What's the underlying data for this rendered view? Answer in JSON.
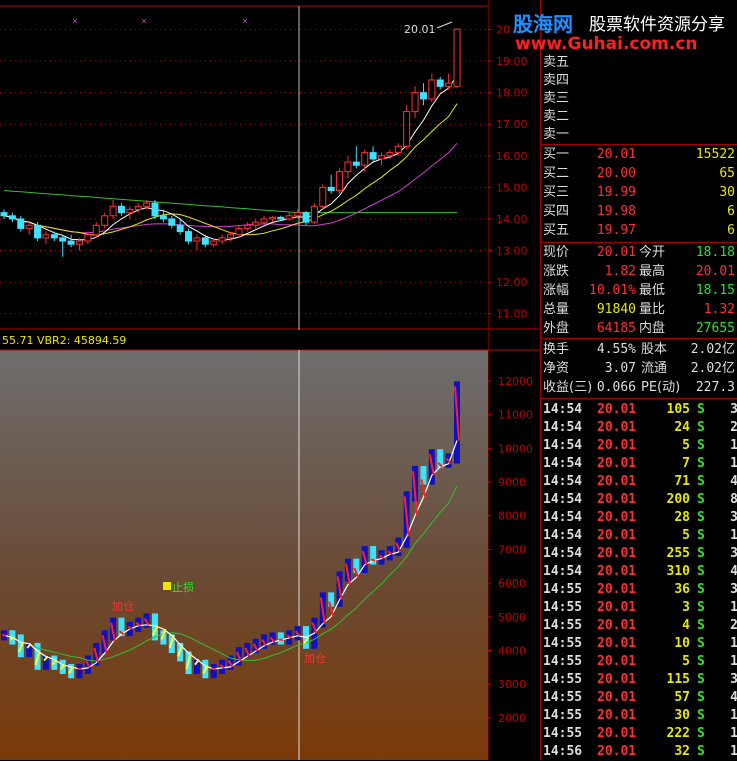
{
  "logo": {
    "brand": "股海网",
    "slogan": "股票软件资源分享",
    "url": "www.Guhai.com.cn"
  },
  "upper": {
    "price_label": "20.01",
    "axis_ticks": [
      "20",
      "19.00",
      "18.00",
      "17.00",
      "16.00",
      "15.00",
      "14.00",
      "13.00",
      "12.00",
      "11.00"
    ],
    "axis_values": [
      20,
      19,
      18,
      17,
      16,
      15,
      14,
      13,
      12,
      11
    ]
  },
  "indicator": {
    "header": "55.71  VBR2: 45894.59",
    "stop_label": "止损",
    "buy_label_1": "加仓",
    "buy_label_2": "加仓",
    "axis_ticks": [
      "12000",
      "11000",
      "10000",
      "9000",
      "8000",
      "7000",
      "6000",
      "5000",
      "4000",
      "3000",
      "2000"
    ],
    "axis_values": [
      12000,
      11000,
      10000,
      9000,
      8000,
      7000,
      6000,
      5000,
      4000,
      3000,
      2000
    ]
  },
  "sell_levels": [
    "卖五",
    "卖四",
    "卖三",
    "卖二",
    "卖一"
  ],
  "bids": [
    {
      "label": "买一",
      "price": "20.01",
      "vol": "15522"
    },
    {
      "label": "买二",
      "price": "20.00",
      "vol": "65"
    },
    {
      "label": "买三",
      "price": "19.99",
      "vol": "30"
    },
    {
      "label": "买四",
      "price": "19.98",
      "vol": "6"
    },
    {
      "label": "买五",
      "price": "19.97",
      "vol": "6"
    }
  ],
  "stats": [
    {
      "l1": "现价",
      "v1": "20.01",
      "c1": "#ff3030",
      "l2": "今开",
      "v2": "18.18",
      "c2": "#30e030"
    },
    {
      "l1": "涨跌",
      "v1": "1.82",
      "c1": "#ff3030",
      "l2": "最高",
      "v2": "20.01",
      "c2": "#ff3030"
    },
    {
      "l1": "涨幅",
      "v1": "10.01%",
      "c1": "#ff3030",
      "l2": "最低",
      "v2": "18.15",
      "c2": "#30e030"
    },
    {
      "l1": "总量",
      "v1": "91840",
      "c1": "#e8e800",
      "l2": "量比",
      "v2": "1.32",
      "c2": "#ff3030"
    },
    {
      "l1": "外盘",
      "v1": "64185",
      "c1": "#ff3030",
      "l2": "内盘",
      "v2": "27655",
      "c2": "#30e030"
    }
  ],
  "fund": [
    {
      "l1": "换手",
      "v1": "4.55%",
      "l2": "股本",
      "v2": "2.02亿"
    },
    {
      "l1": "净资",
      "v1": "3.07",
      "l2": "流通",
      "v2": "2.02亿"
    },
    {
      "l1": "收益(三)",
      "v1": "0.066",
      "l2": "PE(动)",
      "v2": "227.3"
    }
  ],
  "ticks": [
    {
      "t": "14:54",
      "p": "20.01",
      "v": "105",
      "s": "S",
      "n": "3"
    },
    {
      "t": "14:54",
      "p": "20.01",
      "v": "24",
      "s": "S",
      "n": "2"
    },
    {
      "t": "14:54",
      "p": "20.01",
      "v": "5",
      "s": "S",
      "n": "1"
    },
    {
      "t": "14:54",
      "p": "20.01",
      "v": "7",
      "s": "S",
      "n": "1"
    },
    {
      "t": "14:54",
      "p": "20.01",
      "v": "71",
      "s": "S",
      "n": "4"
    },
    {
      "t": "14:54",
      "p": "20.01",
      "v": "200",
      "s": "S",
      "n": "8"
    },
    {
      "t": "14:54",
      "p": "20.01",
      "v": "28",
      "s": "S",
      "n": "3"
    },
    {
      "t": "14:54",
      "p": "20.01",
      "v": "5",
      "s": "S",
      "n": "1"
    },
    {
      "t": "14:54",
      "p": "20.01",
      "v": "255",
      "s": "S",
      "n": "3"
    },
    {
      "t": "14:54",
      "p": "20.01",
      "v": "310",
      "s": "S",
      "n": "4"
    },
    {
      "t": "14:55",
      "p": "20.01",
      "v": "36",
      "s": "S",
      "n": "3"
    },
    {
      "t": "14:55",
      "p": "20.01",
      "v": "3",
      "s": "S",
      "n": "1"
    },
    {
      "t": "14:55",
      "p": "20.01",
      "v": "4",
      "s": "S",
      "n": "2"
    },
    {
      "t": "14:55",
      "p": "20.01",
      "v": "10",
      "s": "S",
      "n": "1"
    },
    {
      "t": "14:55",
      "p": "20.01",
      "v": "5",
      "s": "S",
      "n": "1"
    },
    {
      "t": "14:55",
      "p": "20.01",
      "v": "115",
      "s": "S",
      "n": "3"
    },
    {
      "t": "14:55",
      "p": "20.01",
      "v": "57",
      "s": "S",
      "n": "4"
    },
    {
      "t": "14:55",
      "p": "20.01",
      "v": "30",
      "s": "S",
      "n": "1"
    },
    {
      "t": "14:55",
      "p": "20.01",
      "v": "222",
      "s": "S",
      "n": "1"
    },
    {
      "t": "14:56",
      "p": "20.01",
      "v": "32",
      "s": "S",
      "n": "1"
    }
  ],
  "colors": {
    "up": "#ff3030",
    "down": "#40e0ff",
    "grid": "#c00000",
    "ma5": "#ffffff",
    "ma10": "#e8e800",
    "ma20": "#d040d0",
    "ma60": "#30c030"
  },
  "chart_data": {
    "type": "candlestick",
    "ylim": [
      10.5,
      20.3
    ],
    "candles": [
      [
        14.2,
        14.3,
        14.0,
        14.1
      ],
      [
        14.1,
        14.2,
        13.9,
        14.0
      ],
      [
        14.0,
        14.1,
        13.6,
        13.7
      ],
      [
        13.7,
        13.9,
        13.5,
        13.8
      ],
      [
        13.8,
        13.9,
        13.3,
        13.4
      ],
      [
        13.4,
        13.6,
        13.2,
        13.5
      ],
      [
        13.5,
        13.6,
        13.3,
        13.4
      ],
      [
        13.4,
        13.5,
        12.8,
        13.3
      ],
      [
        13.3,
        13.5,
        13.1,
        13.2
      ],
      [
        13.2,
        13.4,
        13.0,
        13.3
      ],
      [
        13.3,
        13.6,
        13.2,
        13.5
      ],
      [
        13.5,
        13.9,
        13.4,
        13.8
      ],
      [
        13.8,
        14.2,
        13.7,
        14.1
      ],
      [
        14.1,
        14.6,
        14.0,
        14.4
      ],
      [
        14.4,
        14.5,
        14.1,
        14.2
      ],
      [
        14.2,
        14.4,
        14.0,
        14.3
      ],
      [
        14.3,
        14.5,
        14.2,
        14.4
      ],
      [
        14.4,
        14.6,
        14.3,
        14.5
      ],
      [
        14.5,
        14.6,
        14.0,
        14.1
      ],
      [
        14.1,
        14.3,
        13.9,
        14.0
      ],
      [
        14.0,
        14.1,
        13.7,
        13.8
      ],
      [
        13.8,
        14.0,
        13.5,
        13.6
      ],
      [
        13.6,
        13.7,
        13.2,
        13.3
      ],
      [
        13.3,
        13.5,
        13.0,
        13.4
      ],
      [
        13.4,
        13.5,
        13.1,
        13.2
      ],
      [
        13.2,
        13.4,
        13.1,
        13.3
      ],
      [
        13.3,
        13.5,
        13.2,
        13.4
      ],
      [
        13.4,
        13.6,
        13.3,
        13.5
      ],
      [
        13.5,
        13.8,
        13.4,
        13.7
      ],
      [
        13.7,
        13.9,
        13.6,
        13.8
      ],
      [
        13.8,
        14.0,
        13.7,
        13.9
      ],
      [
        13.9,
        14.1,
        13.8,
        14.0
      ],
      [
        14.0,
        14.1,
        13.9,
        14.05
      ],
      [
        14.05,
        14.1,
        13.95,
        14.0
      ],
      [
        14.0,
        14.2,
        13.95,
        14.1
      ],
      [
        14.1,
        14.3,
        14.0,
        14.2
      ],
      [
        14.2,
        14.25,
        13.8,
        13.9
      ],
      [
        13.9,
        14.5,
        13.85,
        14.4
      ],
      [
        14.4,
        15.1,
        14.3,
        15.0
      ],
      [
        15.0,
        15.4,
        14.8,
        14.9
      ],
      [
        14.9,
        15.6,
        14.8,
        15.5
      ],
      [
        15.5,
        16.0,
        15.3,
        15.8
      ],
      [
        15.8,
        16.3,
        15.6,
        15.7
      ],
      [
        15.7,
        16.2,
        15.5,
        16.1
      ],
      [
        16.1,
        16.3,
        15.8,
        15.9
      ],
      [
        15.9,
        16.1,
        15.7,
        16.0
      ],
      [
        16.0,
        16.2,
        15.9,
        16.1
      ],
      [
        16.1,
        16.4,
        16.0,
        16.3
      ],
      [
        16.3,
        17.6,
        16.2,
        17.4
      ],
      [
        17.4,
        18.2,
        17.2,
        18.0
      ],
      [
        18.0,
        18.3,
        17.6,
        17.8
      ],
      [
        17.8,
        18.6,
        17.7,
        18.4
      ],
      [
        18.4,
        18.5,
        18.1,
        18.2
      ],
      [
        18.2,
        18.6,
        18.1,
        18.3
      ],
      [
        18.2,
        20.01,
        18.15,
        20.01
      ]
    ]
  }
}
